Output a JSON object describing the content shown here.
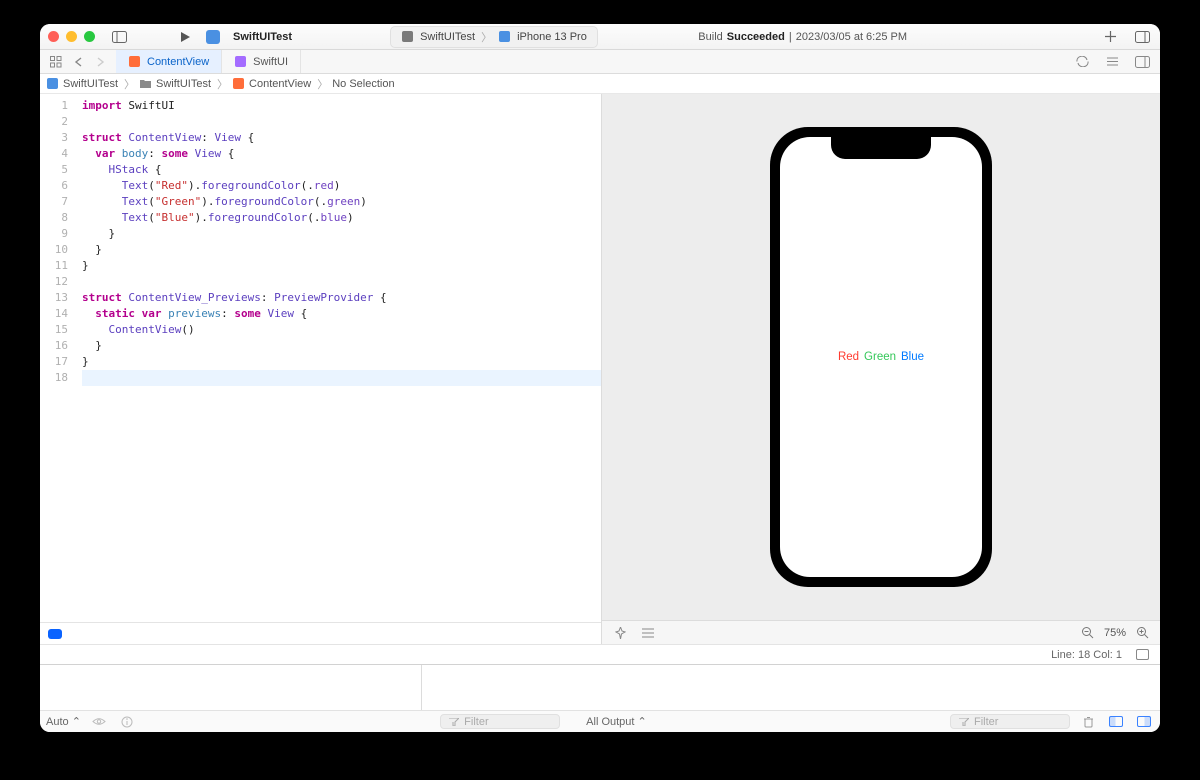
{
  "toolbar": {
    "project": "SwiftUITest",
    "scheme_target": "SwiftUITest",
    "scheme_device": "iPhone 13 Pro",
    "build_prefix": "Build",
    "build_status": "Succeeded",
    "build_timestamp": "2023/03/05 at 6:25 PM"
  },
  "tabs": [
    {
      "label": "ContentView",
      "active": true
    },
    {
      "label": "SwiftUI",
      "active": false
    }
  ],
  "breadcrumb": {
    "project": "SwiftUITest",
    "folder": "SwiftUITest",
    "file": "ContentView",
    "selection": "No Selection"
  },
  "code": {
    "lines": [
      [
        {
          "t": "kw",
          "v": "import"
        },
        {
          "t": "",
          "v": " SwiftUI"
        }
      ],
      [],
      [
        {
          "t": "kw",
          "v": "struct"
        },
        {
          "t": "",
          "v": " "
        },
        {
          "t": "type",
          "v": "ContentView"
        },
        {
          "t": "",
          "v": ": "
        },
        {
          "t": "type",
          "v": "View"
        },
        {
          "t": "",
          "v": " {"
        }
      ],
      [
        {
          "t": "",
          "v": "  "
        },
        {
          "t": "kw",
          "v": "var"
        },
        {
          "t": "",
          "v": " "
        },
        {
          "t": "prop",
          "v": "body"
        },
        {
          "t": "",
          "v": ": "
        },
        {
          "t": "kw",
          "v": "some"
        },
        {
          "t": "",
          "v": " "
        },
        {
          "t": "type",
          "v": "View"
        },
        {
          "t": "",
          "v": " {"
        }
      ],
      [
        {
          "t": "",
          "v": "    "
        },
        {
          "t": "type",
          "v": "HStack"
        },
        {
          "t": "",
          "v": " {"
        }
      ],
      [
        {
          "t": "",
          "v": "      "
        },
        {
          "t": "type",
          "v": "Text"
        },
        {
          "t": "",
          "v": "("
        },
        {
          "t": "str",
          "v": "\"Red\""
        },
        {
          "t": "",
          "v": ")."
        },
        {
          "t": "method",
          "v": "foregroundColor"
        },
        {
          "t": "",
          "v": "(."
        },
        {
          "t": "enum",
          "v": "red"
        },
        {
          "t": "",
          "v": ")"
        }
      ],
      [
        {
          "t": "",
          "v": "      "
        },
        {
          "t": "type",
          "v": "Text"
        },
        {
          "t": "",
          "v": "("
        },
        {
          "t": "str",
          "v": "\"Green\""
        },
        {
          "t": "",
          "v": ")."
        },
        {
          "t": "method",
          "v": "foregroundColor"
        },
        {
          "t": "",
          "v": "(."
        },
        {
          "t": "enum",
          "v": "green"
        },
        {
          "t": "",
          "v": ")"
        }
      ],
      [
        {
          "t": "",
          "v": "      "
        },
        {
          "t": "type",
          "v": "Text"
        },
        {
          "t": "",
          "v": "("
        },
        {
          "t": "str",
          "v": "\"Blue\""
        },
        {
          "t": "",
          "v": ")."
        },
        {
          "t": "method",
          "v": "foregroundColor"
        },
        {
          "t": "",
          "v": "(."
        },
        {
          "t": "enum",
          "v": "blue"
        },
        {
          "t": "",
          "v": ")"
        }
      ],
      [
        {
          "t": "",
          "v": "    }"
        }
      ],
      [
        {
          "t": "",
          "v": "  }"
        }
      ],
      [
        {
          "t": "",
          "v": "}"
        }
      ],
      [],
      [
        {
          "t": "kw",
          "v": "struct"
        },
        {
          "t": "",
          "v": " "
        },
        {
          "t": "type",
          "v": "ContentView_Previews"
        },
        {
          "t": "",
          "v": ": "
        },
        {
          "t": "type",
          "v": "PreviewProvider"
        },
        {
          "t": "",
          "v": " {"
        }
      ],
      [
        {
          "t": "",
          "v": "  "
        },
        {
          "t": "kw",
          "v": "static"
        },
        {
          "t": "",
          "v": " "
        },
        {
          "t": "kw",
          "v": "var"
        },
        {
          "t": "",
          "v": " "
        },
        {
          "t": "prop",
          "v": "previews"
        },
        {
          "t": "",
          "v": ": "
        },
        {
          "t": "kw",
          "v": "some"
        },
        {
          "t": "",
          "v": " "
        },
        {
          "t": "type",
          "v": "View"
        },
        {
          "t": "",
          "v": " {"
        }
      ],
      [
        {
          "t": "",
          "v": "    "
        },
        {
          "t": "type",
          "v": "ContentView"
        },
        {
          "t": "",
          "v": "()"
        }
      ],
      [
        {
          "t": "",
          "v": "  }"
        }
      ],
      [
        {
          "t": "",
          "v": "}"
        }
      ],
      []
    ],
    "cursor_line": 18,
    "cursor_col": 1
  },
  "preview": {
    "items": [
      {
        "text": "Red",
        "color": "#ff3b30"
      },
      {
        "text": "Green",
        "color": "#34c759"
      },
      {
        "text": "Blue",
        "color": "#007aff"
      }
    ]
  },
  "canvas": {
    "zoom_label": "75%"
  },
  "status": {
    "line_col": "Line: 18  Col: 1"
  },
  "debug": {
    "left_selector": "Auto",
    "right_selector": "All Output",
    "filter_placeholder": "Filter"
  }
}
